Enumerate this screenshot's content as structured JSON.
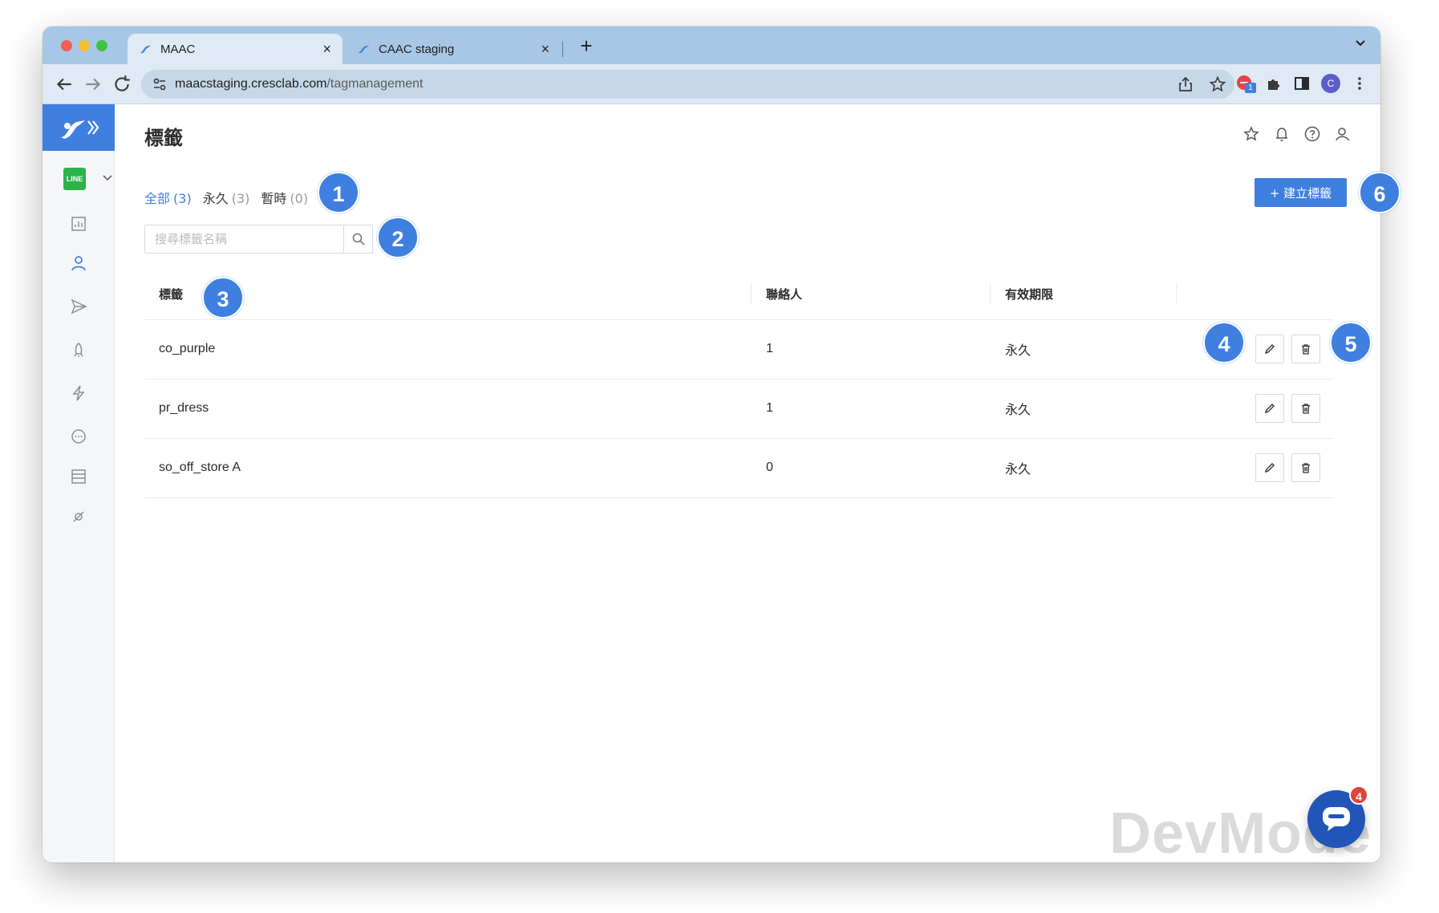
{
  "browser": {
    "tabs": [
      {
        "title": "MAAC",
        "close": "×"
      },
      {
        "title": "CAAC staging",
        "close": "×"
      }
    ],
    "new_tab": "+",
    "url_host": "maacstaging.cresclab.com",
    "url_path": "/tagmanagement",
    "profile_initial": "C",
    "extension_badge": "1"
  },
  "sidebar": {
    "channel": "LINE",
    "icons": [
      "insights-icon",
      "contacts-icon",
      "broadcast-icon",
      "auto-reply-icon",
      "automation-icon",
      "chat-icon",
      "store-icon",
      "integration-icon"
    ]
  },
  "page": {
    "title": "標籤",
    "filters": [
      {
        "label": "全部",
        "count": "(3)",
        "active": true
      },
      {
        "label": "永久",
        "count": "(3)",
        "active": false
      },
      {
        "label": "暫時",
        "count": "(0)",
        "active": false
      }
    ],
    "create_button": "+ 建立標籤",
    "search_placeholder": "搜尋標籤名稱"
  },
  "table": {
    "headers": [
      "標籤",
      "聯絡人",
      "有效期限"
    ],
    "rows": [
      {
        "tag": "co_purple",
        "contacts": "1",
        "expiry": "永久"
      },
      {
        "tag": "pr_dress",
        "contacts": "1",
        "expiry": "永久"
      },
      {
        "tag": "so_off_store A",
        "contacts": "0",
        "expiry": "永久"
      }
    ]
  },
  "callouts": [
    "1",
    "2",
    "3",
    "4",
    "5",
    "6"
  ],
  "chat": {
    "badge": "4"
  },
  "watermark": "DevMode",
  "colors": {
    "accent": "#3f7fe0",
    "callout": "#3f7fe0",
    "tabstrip": "#a8c7e6",
    "line_green": "#2bb34a"
  }
}
